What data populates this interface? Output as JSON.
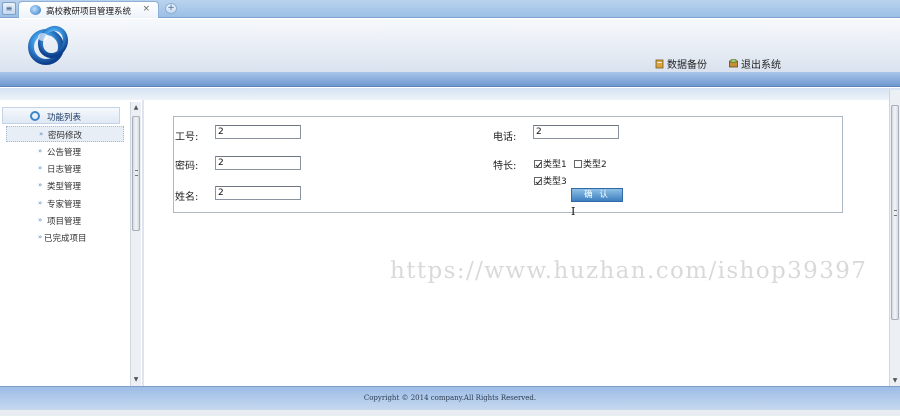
{
  "browser": {
    "tab_title": "高校教研项目管理系统",
    "tab_close": "×",
    "new_tab": "+",
    "sys_button": "≡"
  },
  "header": {
    "backup_label": "数据备份",
    "logout_label": "退出系统"
  },
  "sidebar": {
    "title": "功能列表",
    "items": [
      {
        "label": "密码修改"
      },
      {
        "label": "公告管理"
      },
      {
        "label": "日志管理"
      },
      {
        "label": "类型管理"
      },
      {
        "label": "专家管理"
      },
      {
        "label": "项目管理"
      },
      {
        "label": "已完成项目"
      }
    ]
  },
  "form": {
    "id_label": "工号:",
    "id_value": "2",
    "password_label": "密码:",
    "password_value": "2",
    "name_label": "姓名:",
    "name_value": "2",
    "phone_label": "电话:",
    "phone_value": "2",
    "specialty_label": "特长:",
    "specialties": [
      {
        "label": "类型1",
        "checked": true
      },
      {
        "label": "类型2",
        "checked": false
      },
      {
        "label": "类型3",
        "checked": true
      }
    ],
    "confirm_label": "确 认"
  },
  "watermark": "https://www.huzhan.com/ishop39397",
  "footer": {
    "copyright": "Copyright © 2014 company.All Rights Reserved."
  },
  "colors": {
    "accent": "#6f97cf",
    "button": "#3c7fbf"
  }
}
